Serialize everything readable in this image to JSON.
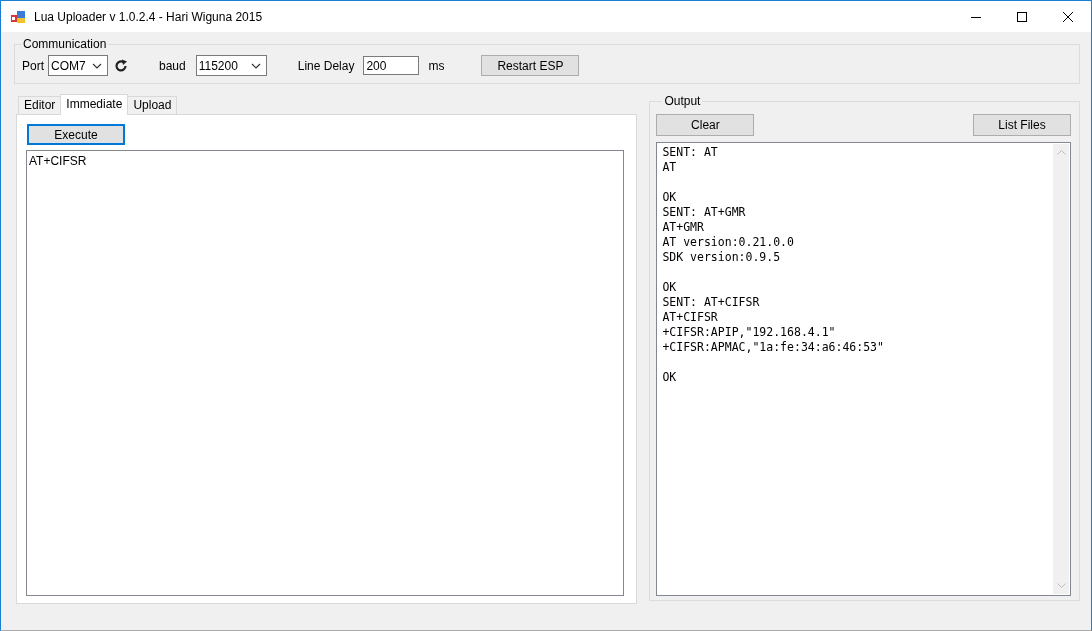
{
  "window": {
    "title": "Lua Uploader v 1.0.2.4 - Hari Wiguna 2015"
  },
  "communication": {
    "title": "Communication",
    "port_label": "Port",
    "port_value": "COM7",
    "baud_label": "baud",
    "baud_value": "115200",
    "line_delay_label": "Line Delay",
    "line_delay_value": "200",
    "ms_label": "ms",
    "restart_button": "Restart ESP"
  },
  "tabs": [
    {
      "label": "Editor",
      "selected": false
    },
    {
      "label": "Immediate",
      "selected": true
    },
    {
      "label": "Upload",
      "selected": false
    }
  ],
  "immediate": {
    "execute_button": "Execute",
    "command_text": "AT+CIFSR"
  },
  "output": {
    "title": "Output",
    "clear_button": "Clear",
    "list_files_button": "List Files",
    "text": "SENT: AT\nAT\n\nOK\nSENT: AT+GMR\nAT+GMR\nAT version:0.21.0.0\nSDK version:0.9.5\n\nOK\nSENT: AT+CIFSR\nAT+CIFSR\n+CIFSR:APIP,\"192.168.4.1\"\n+CIFSR:APMAC,\"1a:fe:34:a6:46:53\"\n\nOK"
  }
}
